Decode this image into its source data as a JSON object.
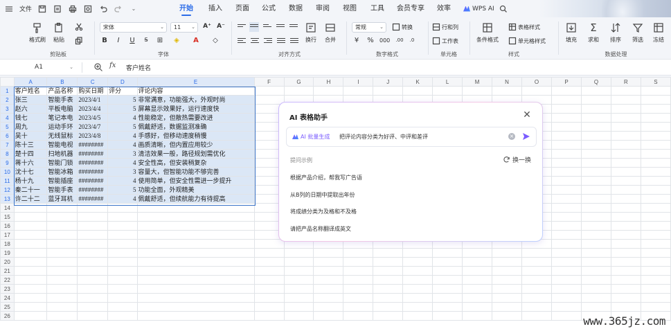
{
  "menubar": {
    "file_label": "文件",
    "tabs": [
      "开始",
      "插入",
      "页面",
      "公式",
      "数据",
      "审阅",
      "视图",
      "工具",
      "会员专享",
      "效率"
    ],
    "active_tab": "开始",
    "wps_ai_label": "WPS AI"
  },
  "ribbon": {
    "format_painter": "格式刷",
    "paste": "粘贴",
    "clipboard_group": "剪贴板",
    "font_name": "宋体",
    "font_size": "11",
    "font_group": "字体",
    "wrap": "换行",
    "merge": "合并",
    "align_group": "对齐方式",
    "number_format": "常规",
    "convert": "转换",
    "number_group": "数字格式",
    "row_col": "行和列",
    "worksheet": "工作表",
    "cell_group": "单元格",
    "cond_format": "条件格式",
    "table_style": "表格样式",
    "cell_style": "单元格样式",
    "style_group": "样式",
    "fill": "填充",
    "sum": "求和",
    "sort": "排序",
    "filter": "筛选",
    "freeze": "冻结",
    "data_group": "数据处理"
  },
  "formula_bar": {
    "cell_ref": "A1",
    "fx": "fx",
    "content": "客户姓名"
  },
  "sheet": {
    "columns": [
      "A",
      "B",
      "C",
      "D",
      "E",
      "F",
      "G",
      "H",
      "I",
      "J",
      "K",
      "L",
      "M",
      "N",
      "O",
      "P",
      "Q",
      "R",
      "S"
    ],
    "row_numbers": [
      "1",
      "2",
      "3",
      "4",
      "5",
      "6",
      "7",
      "8",
      "9",
      "10",
      "11",
      "12",
      "13",
      "14",
      "15",
      "16",
      "17",
      "18",
      "19",
      "20",
      "21",
      "22",
      "23",
      "24",
      "25",
      "26"
    ],
    "header": [
      "客户姓名",
      "产品名称",
      "购买日期",
      "评分",
      "评论内容"
    ],
    "rows": [
      [
        "张三",
        "智能手表",
        "2023/4/1",
        "5",
        "非常满意，功能强大，外观时尚"
      ],
      [
        "赵六",
        "平板电脑",
        "2023/4/4",
        "5",
        "屏幕显示效果好，运行速度快"
      ],
      [
        "钱七",
        "笔记本电",
        "2023/4/5",
        "4",
        "性能稳定，但散热需要改进"
      ],
      [
        "周九",
        "运动手环",
        "2023/4/7",
        "5",
        "佩戴舒适，数据监测准确"
      ],
      [
        "吴十",
        "无线鼠标",
        "2023/4/8",
        "4",
        "手感好，但移动速度稍慢"
      ],
      [
        "陈十三",
        "智能电视",
        "########",
        "4",
        "画质清晰，但内置应用较少"
      ],
      [
        "楚十四",
        "扫地机器",
        "########",
        "3",
        "清洁效果一般，路径规划需优化"
      ],
      [
        "蒋十六",
        "智能门锁",
        "########",
        "4",
        "安全性高，但安装稍复杂"
      ],
      [
        "沈十七",
        "智能冰箱",
        "########",
        "3",
        "容量大，但智能功能不够完善"
      ],
      [
        "杨十九",
        "智能插座",
        "########",
        "4",
        "使用简单，但安全性需进一步提升"
      ],
      [
        "秦二十一",
        "智能手表",
        "########",
        "5",
        "功能全面，外观精美"
      ],
      [
        "许二十二",
        "蓝牙耳机",
        "########",
        "4",
        "佩戴舒适，但续航能力有待提高"
      ]
    ]
  },
  "ai_panel": {
    "title": "AI 表格助手",
    "mode_label": "AI 批量生成",
    "input_text": "把评论内容分类为好评、中评和差评",
    "hint_label": "提问示例",
    "refresh_label": "换一换",
    "examples": [
      "根据产品介绍，帮我写广告语",
      "从B列的日期中提取出年份",
      "将成绩分类为及格和不及格",
      "请把产品名称翻译成英文"
    ]
  },
  "watermark": "www.365jz.com"
}
